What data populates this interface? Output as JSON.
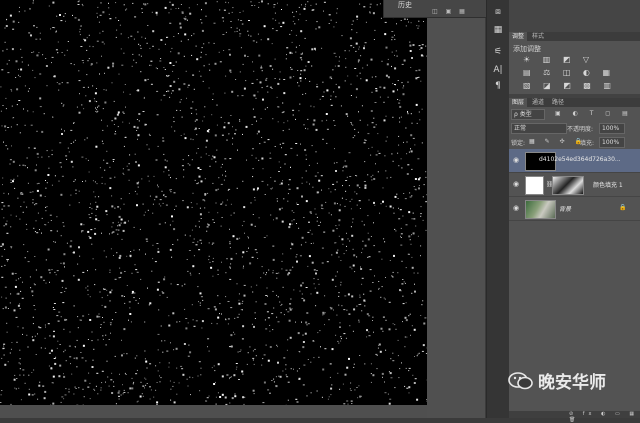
{
  "floating_panel": {
    "title": "历史"
  },
  "adjustments": {
    "tabs": [
      "调整",
      "样式"
    ],
    "title": "添加调整",
    "row1": "☀ ▥ ◩ ▽",
    "row2": "▤ ⚖ ◫ ◐ ▦",
    "row3": "▧ ◪ ◩ ▩ ▥"
  },
  "layers": {
    "tabs": [
      "图层",
      "通道",
      "路径"
    ],
    "filter_kind": "ρ 类型",
    "blend_mode": "正常",
    "opacity_label": "不透明度:",
    "opacity_value": "100%",
    "lock_label": "锁定:",
    "fill_label": "填充:",
    "fill_value": "100%",
    "items": [
      {
        "name": "d4102e54ed364d726a30..."
      },
      {
        "name": "颜色填充 1"
      },
      {
        "name": "背景"
      }
    ]
  },
  "watermark": {
    "text": "晚安华师"
  },
  "colors": {
    "canvas": "#000000",
    "selected_layer": "#5d6a86",
    "panel": "#535353"
  }
}
